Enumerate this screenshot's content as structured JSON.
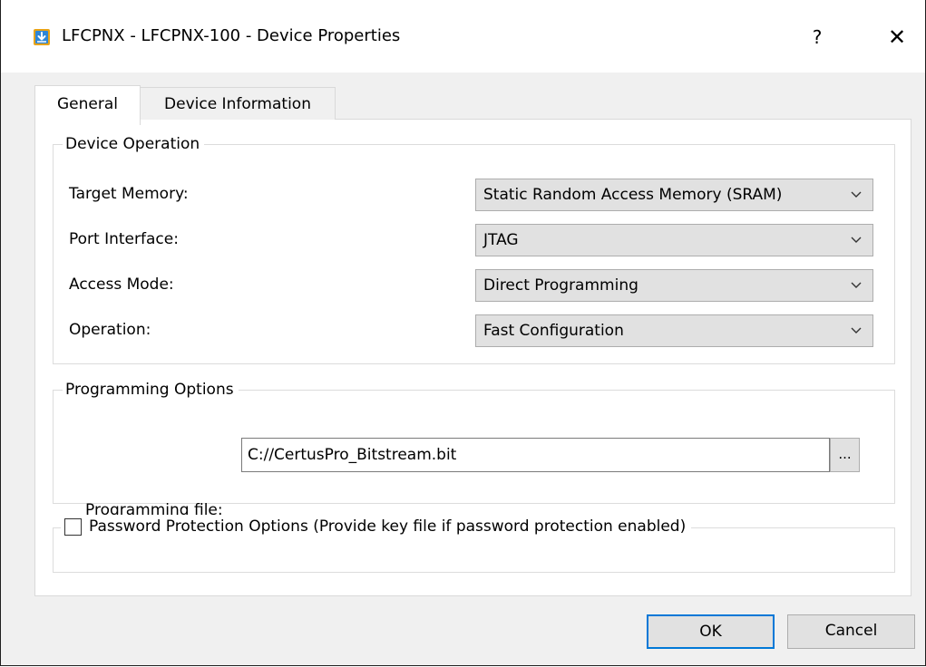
{
  "window": {
    "title": "LFCPNX - LFCPNX-100 - Device Properties",
    "help_label": "?",
    "close_label": "✕"
  },
  "tabs": [
    {
      "label": "General",
      "selected": true
    },
    {
      "label": "Device Information",
      "selected": false
    }
  ],
  "device_operation": {
    "title": "Device Operation",
    "rows": [
      {
        "label": "Target Memory:",
        "value": "Static Random Access Memory (SRAM)"
      },
      {
        "label": "Port Interface:",
        "value": "JTAG"
      },
      {
        "label": "Access Mode:",
        "value": "Direct Programming"
      },
      {
        "label": "Operation:",
        "value": "Fast Configuration"
      }
    ]
  },
  "programming_options": {
    "title": "Programming Options",
    "file_label": "Programming file:",
    "file_value": "C://CertusPro_Bitstream.bit",
    "browse_label": "..."
  },
  "password_protection": {
    "label": "Password Protection Options (Provide key file if password protection enabled)",
    "checked": false
  },
  "buttons": {
    "ok": "OK",
    "cancel": "Cancel"
  },
  "colors": {
    "accent": "#0078d7",
    "icon_blue": "#2e86d6",
    "icon_yellow": "#e8a317"
  }
}
